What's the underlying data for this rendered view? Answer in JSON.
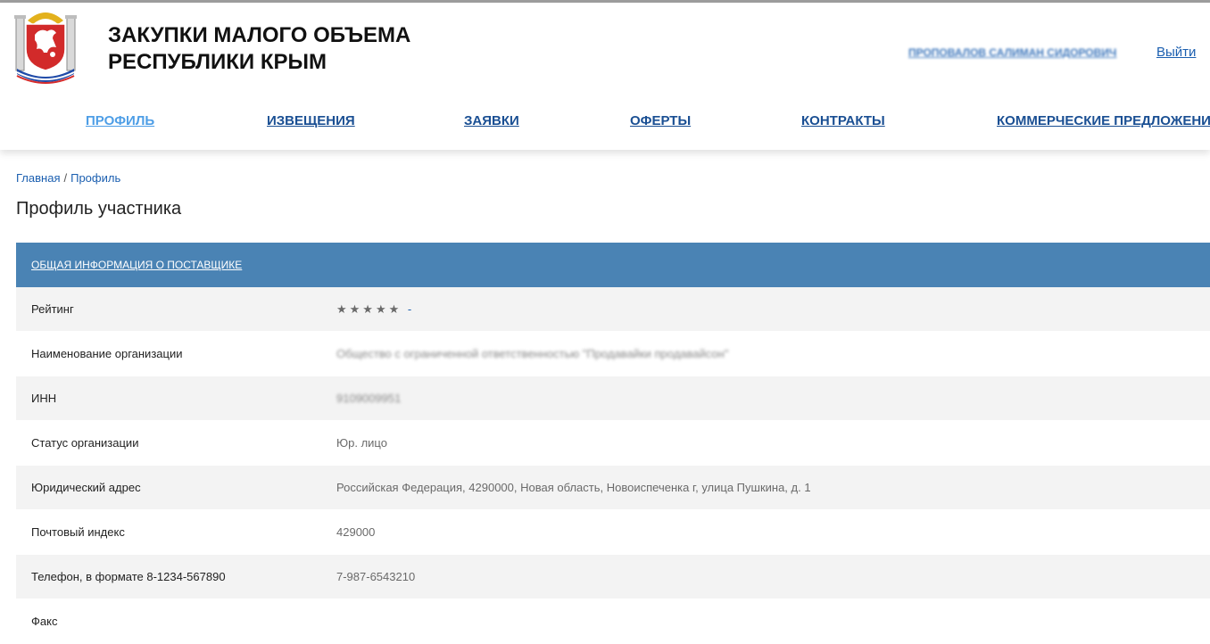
{
  "header": {
    "title_line1": "ЗАКУПКИ МАЛОГО ОБЪЕМА",
    "title_line2": "РЕСПУБЛИКИ КРЫМ",
    "user_name": "ПРОПОВАЛОВ САЛИМАН СИДОРОВИЧ",
    "logout_label": "Выйти"
  },
  "nav": {
    "items": [
      {
        "label": "ПРОФИЛЬ",
        "active": true
      },
      {
        "label": "ИЗВЕЩЕНИЯ"
      },
      {
        "label": "ЗАЯВКИ"
      },
      {
        "label": "ОФЕРТЫ"
      },
      {
        "label": "КОНТРАКТЫ"
      },
      {
        "label": "КОММЕРЧЕСКИЕ ПРЕДЛОЖЕНИЯ"
      }
    ]
  },
  "breadcrumb": {
    "items": [
      "Главная",
      "Профиль"
    ],
    "separator": "/"
  },
  "page": {
    "title": "Профиль участника"
  },
  "table": {
    "header": "ОБЩАЯ ИНФОРМАЦИЯ О ПОСТАВЩИКЕ",
    "rows": [
      {
        "label": "Рейтинг",
        "value": "★★★★★",
        "extra": "-"
      },
      {
        "label": "Наименование организации",
        "value": "Общество с ограниченной ответственностью \"Продавайки продавайсон\""
      },
      {
        "label": "ИНН",
        "value": "9109009951"
      },
      {
        "label": "Статус организации",
        "value": "Юр. лицо"
      },
      {
        "label": "Юридический адрес",
        "value": "Российская Федерация, 4290000, Новая область, Новоиспеченка г, улица Пушкина, д. 1"
      },
      {
        "label": "Почтовый индекс",
        "value": "429000"
      },
      {
        "label": "Телефон, в формате 8-1234-567890",
        "value": "7-987-6543210"
      },
      {
        "label": "Факс",
        "value": ""
      }
    ]
  },
  "colors": {
    "accent": "#4a83b4",
    "nav_link": "#1a4f93",
    "nav_active": "#4e9ee6",
    "link": "#1b5fb0"
  },
  "icons": {
    "emblem": "crimea-coat-of-arms-icon",
    "rating": "star-icon"
  }
}
